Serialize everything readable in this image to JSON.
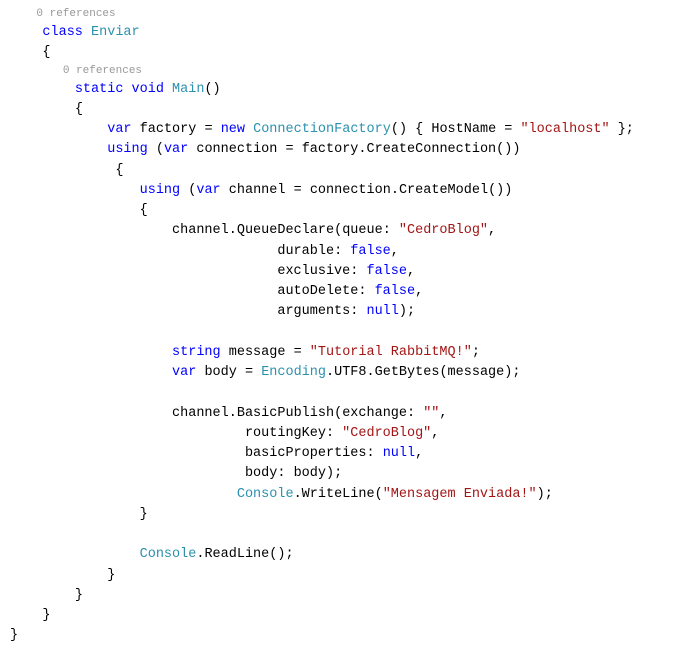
{
  "codelens": {
    "class": "0 references",
    "main": "0 references"
  },
  "kw": {
    "class": "class",
    "static": "static",
    "void": "void",
    "var": "var",
    "new": "new",
    "using": "using",
    "string": "string",
    "false": "false",
    "null": "null"
  },
  "type": {
    "Enviar": "Enviar",
    "Main": "Main",
    "ConnectionFactory": "ConnectionFactory",
    "Encoding": "Encoding",
    "Console": "Console"
  },
  "id": {
    "factory": "factory",
    "connection": "connection",
    "channel": "channel",
    "message": "message",
    "body": "body",
    "HostName": "HostName",
    "CreateConnection": "CreateConnection",
    "CreateModel": "CreateModel",
    "QueueDeclare": "QueueDeclare",
    "BasicPublish": "BasicPublish",
    "WriteLine": "WriteLine",
    "ReadLine": "ReadLine",
    "GetBytes": "GetBytes",
    "UTF8": "UTF8",
    "queue": "queue",
    "durable": "durable",
    "exclusive": "exclusive",
    "autoDelete": "autoDelete",
    "arguments": "arguments",
    "exchange": "exchange",
    "routingKey": "routingKey",
    "basicProperties": "basicProperties",
    "bodyParam": "body"
  },
  "str": {
    "localhost": "\"localhost\"",
    "CedroBlog": "\"CedroBlog\"",
    "Tutorial": "\"Tutorial RabbitMQ!\"",
    "empty": "\"\"",
    "Mensagem": "\"Mensagem Enviada!\""
  },
  "punct": {
    "obrace": "{",
    "cbrace": "}",
    "oparen": "(",
    "cparen": ")",
    "semi": ";",
    "colon": ":",
    "comma": ",",
    "dot": ".",
    "eq": "=",
    "space": " "
  }
}
